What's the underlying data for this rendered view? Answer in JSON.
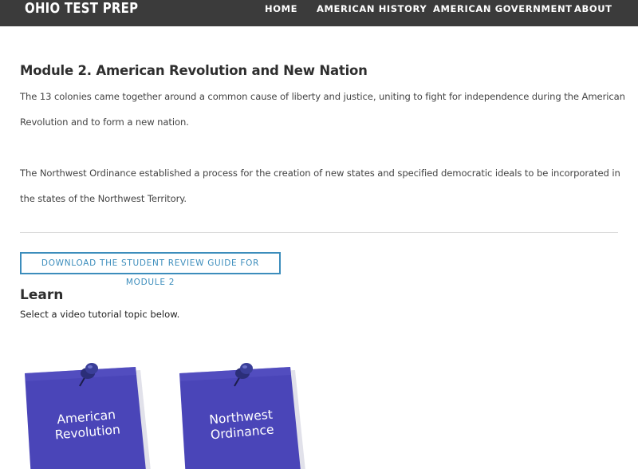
{
  "nav": {
    "brand": "OHIO TEST PREP",
    "links": [
      "HOME",
      "AMERICAN HISTORY",
      "AMERICAN GOVERNMENT",
      "ABOUT"
    ]
  },
  "main": {
    "title": "Module 2. American Revolution and New Nation",
    "paragraphs": [
      "The 13 colonies came together around a common cause of liberty and justice, uniting to fight for independence during the American Revolution and to form a new nation.",
      "The Northwest Ordinance established a process for the creation of new states and specified democratic ideals to be incorporated in the states of the Northwest Territory."
    ],
    "download_label": "DOWNLOAD THE STUDENT REVIEW GUIDE FOR MODULE 2",
    "learn_heading": "Learn",
    "learn_subtitle": "Select a video tutorial topic below.",
    "topics": [
      {
        "line1": "American",
        "line2": "Revolution"
      },
      {
        "line1": "Northwest",
        "line2": "Ordinance"
      }
    ]
  },
  "colors": {
    "nav_bg": "#3b3b3b",
    "accent": "#3c8dbc",
    "card_blue": "#4a45b8",
    "pin": "#2b2e78"
  },
  "icons": [
    "pushpin-icon"
  ]
}
